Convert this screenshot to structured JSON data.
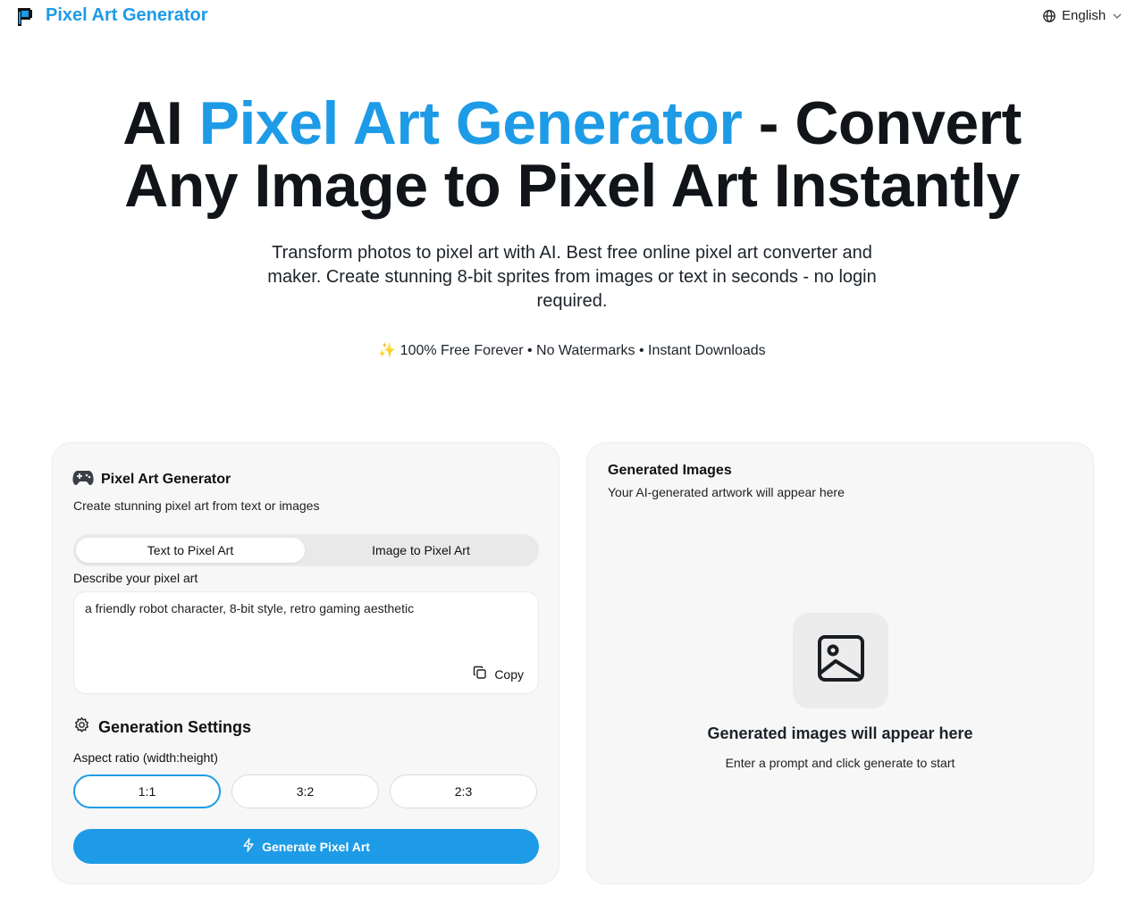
{
  "header": {
    "brand": "Pixel Art Generator",
    "logo_icon": "pixel-p-logo",
    "language": "English",
    "accent_color": "#1e9be6"
  },
  "hero": {
    "title_prefix": "AI ",
    "title_accent": "Pixel Art Generator",
    "title_line1_suffix": " - Convert",
    "title_line2": "Any Image to Pixel Art Instantly",
    "subtitle": "Transform photos to pixel art with AI. Best free online pixel art converter and maker. Create stunning 8-bit sprites from images or text in seconds - no login required.",
    "badges": "✨ 100% Free Forever • No Watermarks • Instant Downloads"
  },
  "generator": {
    "icon": "gamepad-icon",
    "title": "Pixel Art Generator",
    "description": "Create stunning pixel art from text or images",
    "tabs": [
      {
        "label": "Text to Pixel Art",
        "active": true
      },
      {
        "label": "Image to Pixel Art",
        "active": false
      }
    ],
    "prompt_label": "Describe your pixel art",
    "prompt_value": "a friendly robot character, 8-bit style, retro gaming aesthetic",
    "copy_label": "Copy",
    "settings_title": "Generation Settings",
    "aspect_label": "Aspect ratio (width:height)",
    "aspect_ratios": [
      {
        "label": "1:1",
        "selected": true
      },
      {
        "label": "3:2",
        "selected": false
      },
      {
        "label": "2:3",
        "selected": false
      }
    ],
    "generate_label": "Generate Pixel Art"
  },
  "output": {
    "title": "Generated Images",
    "description": "Your AI-generated artwork will appear here",
    "empty_title": "Generated images will appear here",
    "empty_description": "Enter a prompt and click generate to start"
  }
}
